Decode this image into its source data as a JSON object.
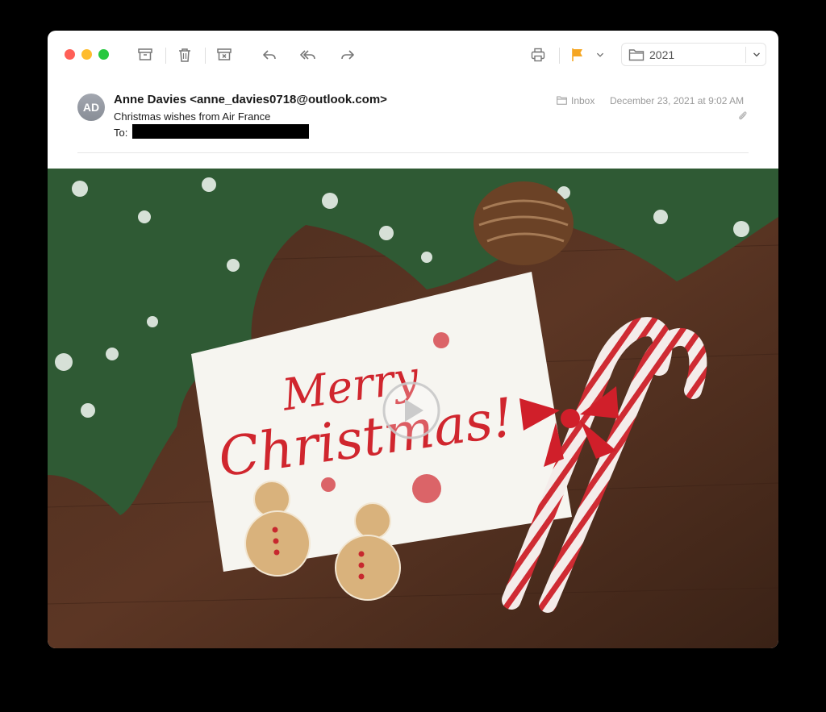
{
  "window": {
    "toolbar": {
      "traffic_lights": [
        {
          "name": "close",
          "color": "#ff5f57"
        },
        {
          "name": "minimize",
          "color": "#febc2e"
        },
        {
          "name": "zoom",
          "color": "#28c840"
        }
      ],
      "buttons": [
        "archive-icon",
        "trash-icon",
        "junk-icon",
        "reply-icon",
        "reply-all-icon",
        "forward-icon",
        "print-icon",
        "flag-icon",
        "flag-menu-icon"
      ],
      "flag_color": "#f5a623",
      "mailbox_label": "2021"
    }
  },
  "message": {
    "avatar_initials": "AD",
    "from": "Anne Davies <anne_davies0718@outlook.com>",
    "subject": "Christmas wishes from Air France",
    "to_label": "To:",
    "mailbox": "Inbox",
    "date": "December 23, 2021 at 9:02 AM",
    "has_attachment_icon": "paperclip-icon"
  },
  "body": {
    "card_text_line1": "Merry",
    "card_text_line2": "Christmas!",
    "play_icon": "play-icon",
    "accent_red": "#d0262e"
  }
}
